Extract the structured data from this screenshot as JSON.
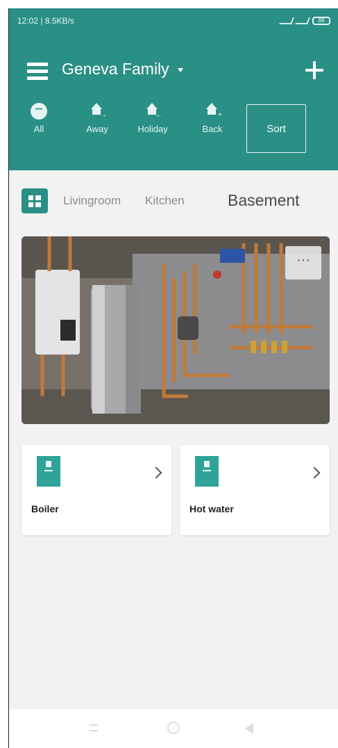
{
  "status_bar": {
    "time_speed": "12:02 | 8.5KB/s",
    "battery": "88"
  },
  "header": {
    "home_name": "Geneva Family"
  },
  "modes": [
    {
      "label": "All",
      "icon": "more-circle-icon"
    },
    {
      "label": "Away",
      "icon": "house-away-icon"
    },
    {
      "label": "Holiday",
      "icon": "house-holiday-icon"
    },
    {
      "label": "Back",
      "icon": "house-back-icon"
    }
  ],
  "sort_label": "Sort",
  "rooms": [
    "Livingroom",
    "Kitchen",
    "Basement"
  ],
  "active_room": "Basement",
  "photo": {
    "description_icon": "boiler-room-photo",
    "menu_label": "···"
  },
  "devices": [
    {
      "label": "Boiler",
      "icon": "thermostat-icon"
    },
    {
      "label": "Hot water",
      "icon": "thermostat-icon"
    }
  ],
  "colors": {
    "accent": "#2a8f85",
    "background": "#f2f2f2",
    "card": "#ffffff"
  }
}
